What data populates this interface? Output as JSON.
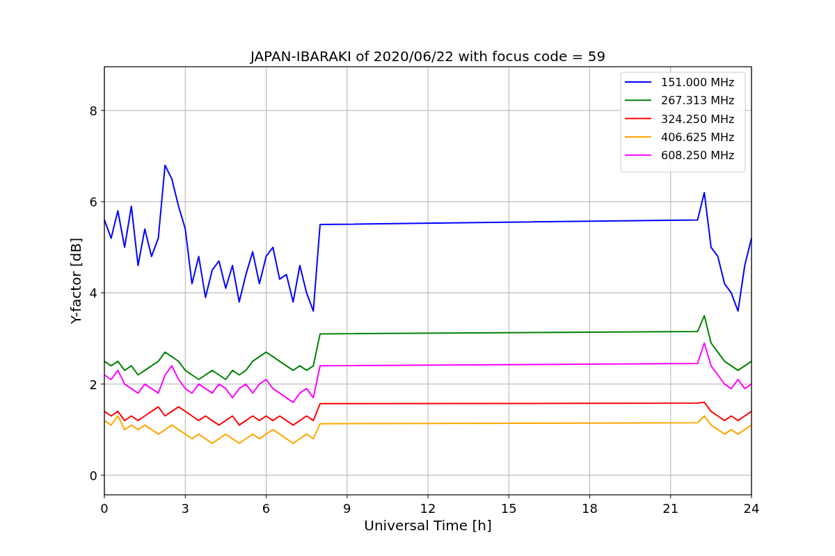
{
  "figure": {
    "chart_data": {
      "type": "line",
      "title": "JAPAN-IBARAKI of 2020/06/22 with focus code = 59",
      "xlabel": "Universal Time [h]",
      "ylabel": "Y-factor [dB]",
      "x": [
        0,
        0.25,
        0.5,
        0.75,
        1,
        1.25,
        1.5,
        1.75,
        2,
        2.25,
        2.5,
        2.75,
        3,
        3.25,
        3.5,
        3.75,
        4,
        4.25,
        4.5,
        4.75,
        5,
        5.25,
        5.5,
        5.75,
        6,
        6.25,
        6.5,
        6.75,
        7,
        7.25,
        7.5,
        7.75,
        8,
        22,
        22.25,
        22.5,
        22.75,
        23,
        23.25,
        23.5,
        23.75,
        24
      ],
      "series": [
        {
          "name": "151.000 MHz",
          "color": "#0000ff",
          "values": [
            5.6,
            5.2,
            5.8,
            5.0,
            5.9,
            4.6,
            5.4,
            4.8,
            5.2,
            6.8,
            6.5,
            5.9,
            5.4,
            4.2,
            4.8,
            3.9,
            4.5,
            4.7,
            4.1,
            4.6,
            3.8,
            4.4,
            4.9,
            4.2,
            4.8,
            5.0,
            4.3,
            4.4,
            3.8,
            4.6,
            4.0,
            3.6,
            5.5,
            5.6,
            6.2,
            5.0,
            4.8,
            4.2,
            4.0,
            3.6,
            4.6,
            5.2
          ]
        },
        {
          "name": "267.313 MHz",
          "color": "#008000",
          "values": [
            2.5,
            2.4,
            2.5,
            2.3,
            2.4,
            2.2,
            2.3,
            2.4,
            2.5,
            2.7,
            2.6,
            2.5,
            2.3,
            2.2,
            2.1,
            2.2,
            2.3,
            2.2,
            2.1,
            2.3,
            2.2,
            2.3,
            2.5,
            2.6,
            2.7,
            2.6,
            2.5,
            2.4,
            2.3,
            2.4,
            2.3,
            2.4,
            3.1,
            3.15,
            3.5,
            2.9,
            2.7,
            2.5,
            2.4,
            2.3,
            2.4,
            2.5
          ]
        },
        {
          "name": "324.250 MHz",
          "color": "#ff0000",
          "values": [
            1.4,
            1.3,
            1.4,
            1.2,
            1.3,
            1.2,
            1.3,
            1.4,
            1.5,
            1.3,
            1.4,
            1.5,
            1.4,
            1.3,
            1.2,
            1.3,
            1.2,
            1.1,
            1.2,
            1.3,
            1.1,
            1.2,
            1.3,
            1.2,
            1.3,
            1.2,
            1.3,
            1.2,
            1.1,
            1.2,
            1.3,
            1.2,
            1.57,
            1.58,
            1.6,
            1.4,
            1.3,
            1.2,
            1.3,
            1.2,
            1.3,
            1.4
          ]
        },
        {
          "name": "406.625 MHz",
          "color": "#ffa500",
          "values": [
            1.2,
            1.1,
            1.3,
            1.0,
            1.1,
            1.0,
            1.1,
            1.0,
            0.9,
            1.0,
            1.1,
            1.0,
            0.9,
            0.8,
            0.9,
            0.8,
            0.7,
            0.8,
            0.9,
            0.8,
            0.7,
            0.8,
            0.9,
            0.8,
            0.9,
            1.0,
            0.9,
            0.8,
            0.7,
            0.8,
            0.9,
            0.8,
            1.13,
            1.15,
            1.3,
            1.1,
            1.0,
            0.9,
            1.0,
            0.9,
            1.0,
            1.1
          ]
        },
        {
          "name": "608.250 MHz",
          "color": "#ff00ff",
          "values": [
            2.2,
            2.1,
            2.3,
            2.0,
            1.9,
            1.8,
            2.0,
            1.9,
            1.8,
            2.2,
            2.4,
            2.1,
            1.9,
            1.8,
            2.0,
            1.9,
            1.8,
            2.0,
            1.9,
            1.7,
            1.9,
            2.0,
            1.8,
            2.0,
            2.1,
            1.9,
            1.8,
            1.7,
            1.6,
            1.8,
            1.9,
            1.7,
            2.4,
            2.45,
            2.9,
            2.4,
            2.2,
            2.0,
            1.9,
            2.1,
            1.9,
            2.0
          ]
        }
      ],
      "xlim": [
        0,
        24
      ],
      "ylim": [
        -0.43,
        8.96
      ],
      "xticks": [
        0,
        3,
        6,
        9,
        12,
        15,
        18,
        21,
        24
      ],
      "yticks": [
        0,
        2,
        4,
        6,
        8
      ],
      "grid": true,
      "legend": true
    }
  }
}
